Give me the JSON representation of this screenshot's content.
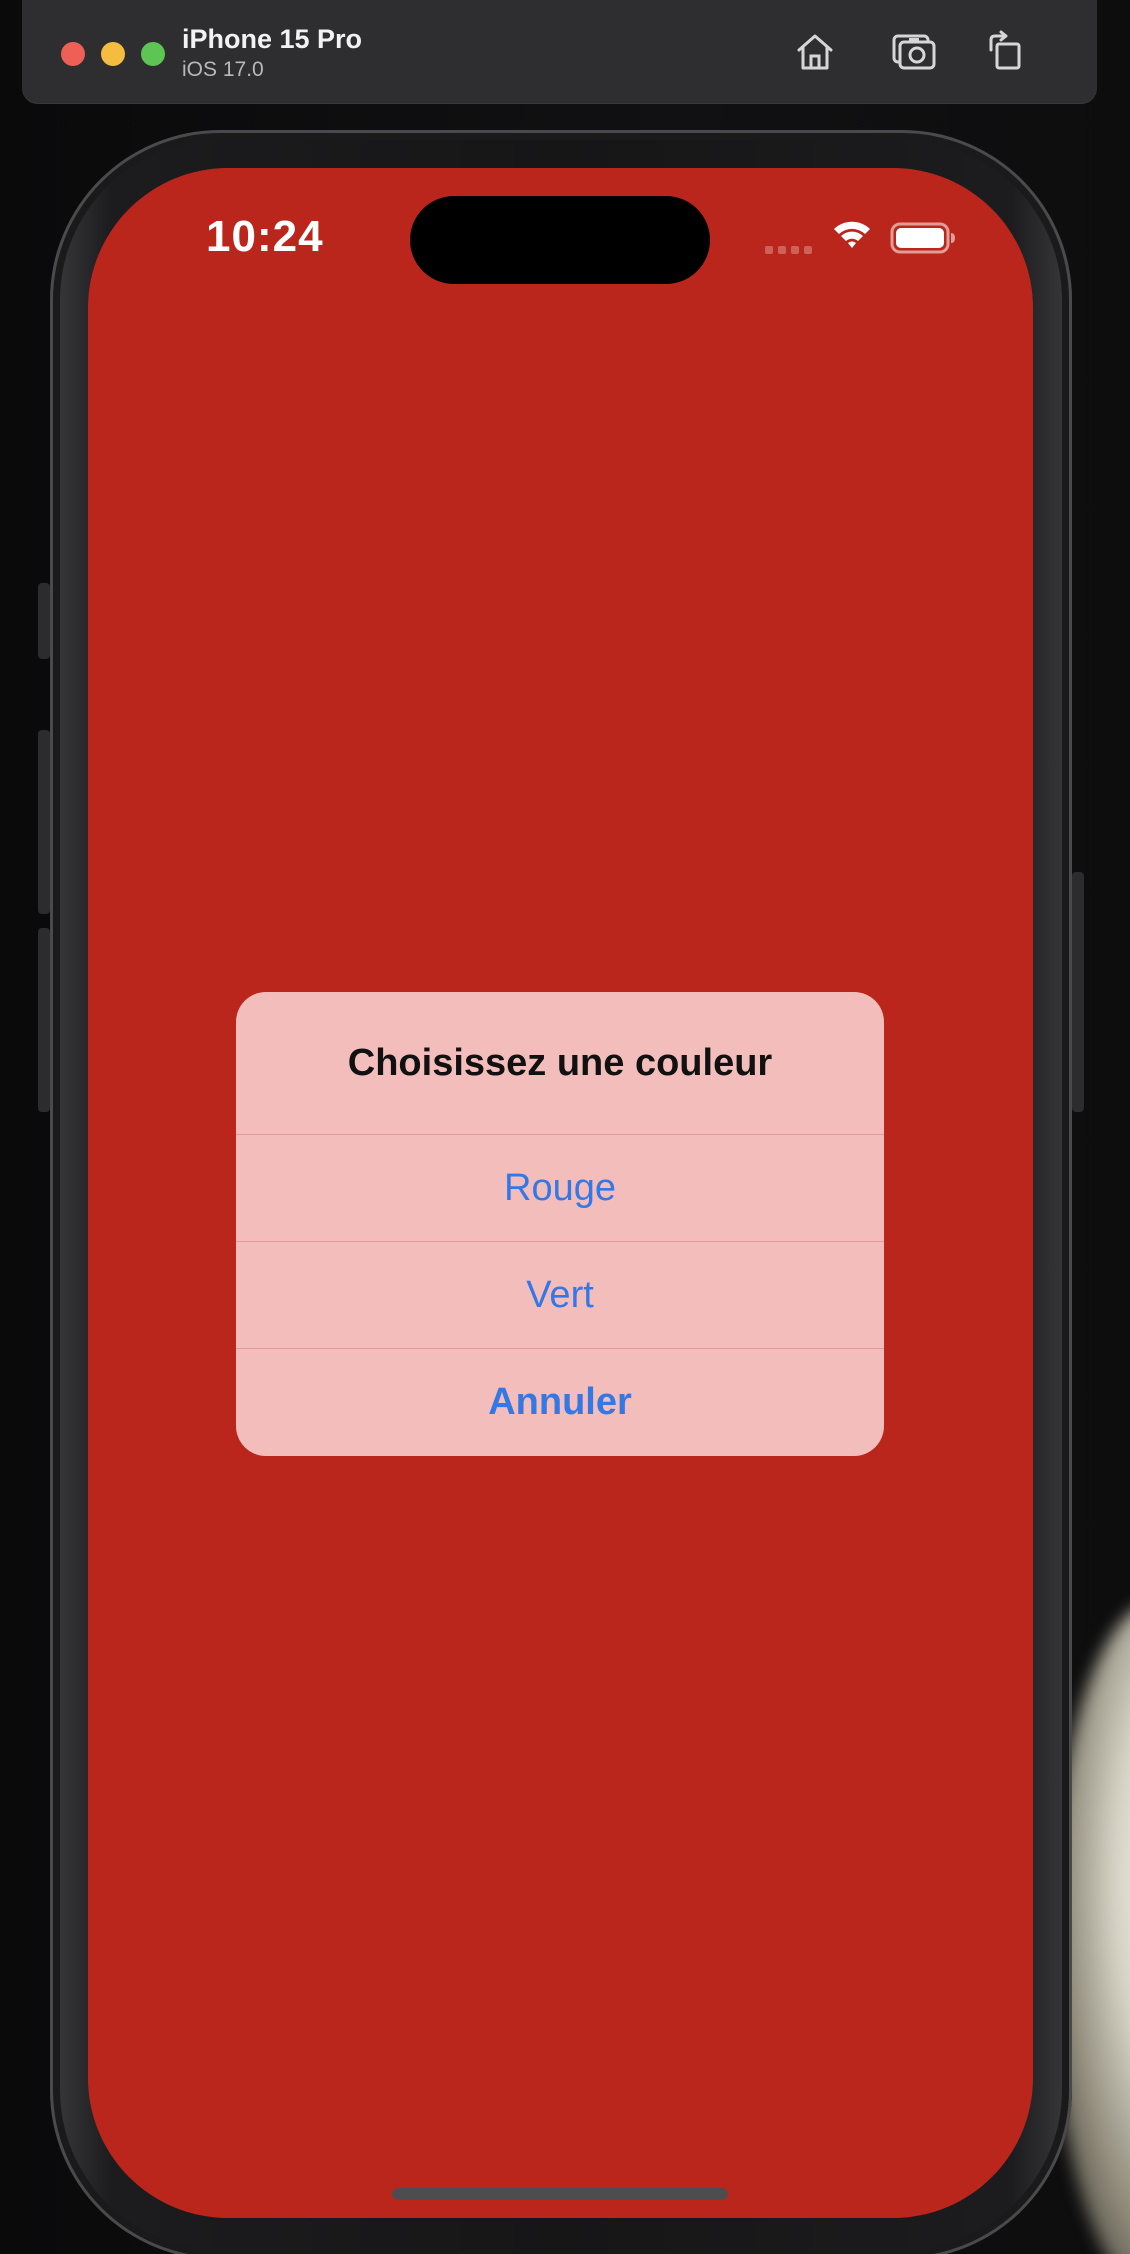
{
  "simulator": {
    "device_name": "iPhone 15 Pro",
    "os_version": "iOS 17.0",
    "toolbar": {
      "home_icon": "home-icon",
      "screenshot_icon": "camera-icon",
      "rotate_icon": "rotate-icon"
    }
  },
  "status_bar": {
    "time": "10:24",
    "wifi_icon": "wifi-icon",
    "battery_icon": "battery-icon"
  },
  "screen": {
    "background_color": "#bb261c"
  },
  "alert": {
    "title": "Choisissez une couleur",
    "buttons": [
      {
        "label": "Rouge",
        "style": "default"
      },
      {
        "label": "Vert",
        "style": "default"
      },
      {
        "label": "Annuler",
        "style": "cancel"
      }
    ],
    "background_color": "#f3bdbc",
    "button_color": "#3478e6"
  }
}
